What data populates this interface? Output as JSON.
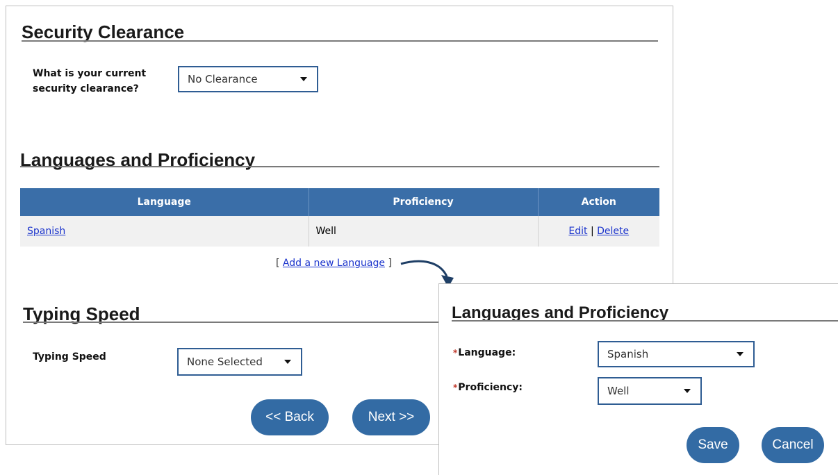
{
  "security": {
    "title": "Security Clearance",
    "question": "What is your current security clearance?",
    "selected": "No Clearance"
  },
  "languages": {
    "title": "Languages and Proficiency",
    "columns": [
      "Language",
      "Proficiency",
      "Action"
    ],
    "rows": [
      {
        "language": "Spanish",
        "proficiency": "Well",
        "edit": "Edit",
        "sep": "|",
        "delete": "Delete"
      }
    ],
    "add_prefix": "[",
    "add_link": "Add a new Language",
    "add_suffix": "]"
  },
  "typing": {
    "title": "Typing Speed",
    "label": "Typing Speed",
    "selected": "None Selected"
  },
  "nav": {
    "back": "<< Back",
    "next": "Next >>"
  },
  "dialog": {
    "title": "Languages and Proficiency",
    "required_mark": "*",
    "language_label": "Language:",
    "language_value": "Spanish",
    "proficiency_label": "Proficiency:",
    "proficiency_value": "Well",
    "save": "Save",
    "cancel": "Cancel"
  },
  "colors": {
    "accent": "#336ba4",
    "header": "#3a6ea8",
    "link": "#1a33cc",
    "arrow": "#1f3f66"
  },
  "icons": [
    "chevron-down-icon",
    "curved-arrow-icon"
  ]
}
